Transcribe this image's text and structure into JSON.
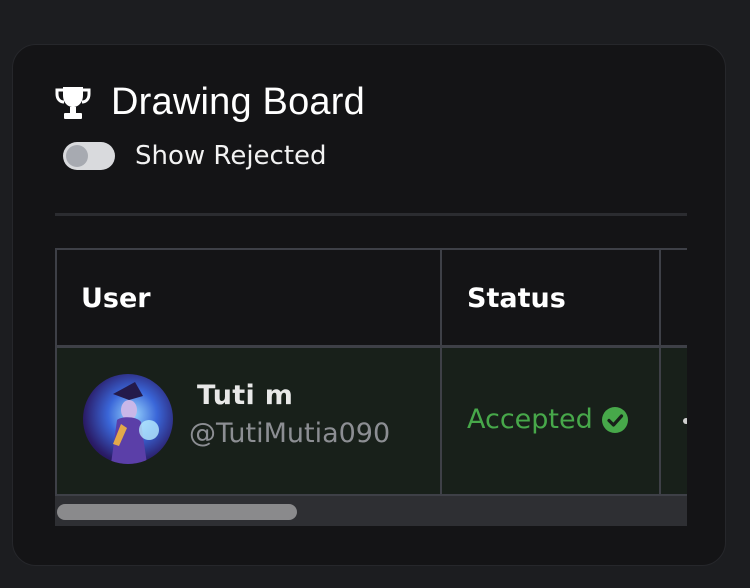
{
  "header": {
    "icon": "trophy-icon",
    "title": "Drawing Board"
  },
  "filter": {
    "toggle_state": "off",
    "label": "Show Rejected"
  },
  "table": {
    "columns": [
      "User",
      "Status"
    ],
    "rows": [
      {
        "user_name": "Tuti m",
        "user_handle": "@TutiMutia090",
        "status": "Accepted",
        "status_icon": "check-circle-icon"
      }
    ]
  },
  "colors": {
    "accepted": "#47a84a",
    "row_highlight": "#18201a",
    "card_bg": "#141416"
  }
}
